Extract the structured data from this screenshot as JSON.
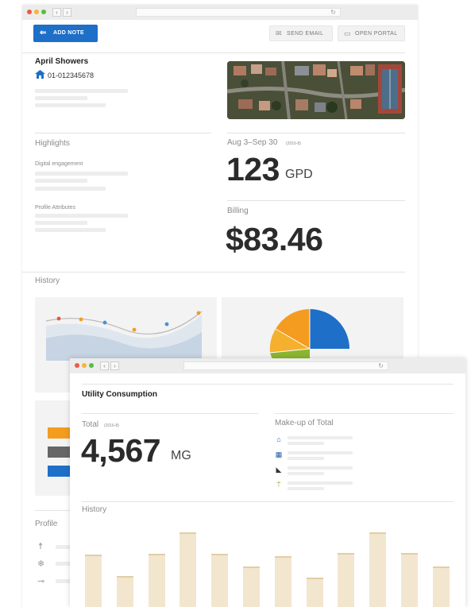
{
  "back_window": {
    "toolbar": {
      "add_note_label": "ADD NOTE",
      "send_email_label": "SEND EMAIL",
      "open_portal_label": "OPEN PORTAL"
    },
    "account": {
      "name": "April Showers",
      "id": "01-012345678"
    },
    "highlights": {
      "title": "Highlights",
      "digital_engagement_label": "Digital engagement",
      "profile_attributes_label": "Profile Attributes"
    },
    "usage": {
      "period": "Aug 3–Sep 30",
      "period_note": "(2016-8)",
      "value": "123",
      "unit": "GPD"
    },
    "billing": {
      "label": "Billing",
      "amount": "$83.46"
    },
    "history": {
      "title": "History"
    },
    "profile": {
      "title": "Profile"
    },
    "colors": {
      "accent_blue": "#1e6fc8",
      "bar_orange": "#f39c1f",
      "bar_gray": "#666666",
      "pie_green": "#8bb531"
    }
  },
  "front_window": {
    "title": "Utility Consumption",
    "total": {
      "label": "Total",
      "note": "(2016-8)",
      "value": "4,567",
      "unit": "MG"
    },
    "makeup": {
      "title": "Make-up of Total",
      "icons": [
        "house-icon",
        "building-icon",
        "faucet-icon",
        "sprinkler-icon"
      ]
    },
    "history": {
      "title": "History",
      "bar_levels": [
        0.62,
        0.36,
        0.63,
        0.88,
        0.63,
        0.48,
        0.6,
        0.35,
        0.64,
        0.88,
        0.64,
        0.48
      ],
      "bar_color": "#f3e6cf"
    }
  }
}
